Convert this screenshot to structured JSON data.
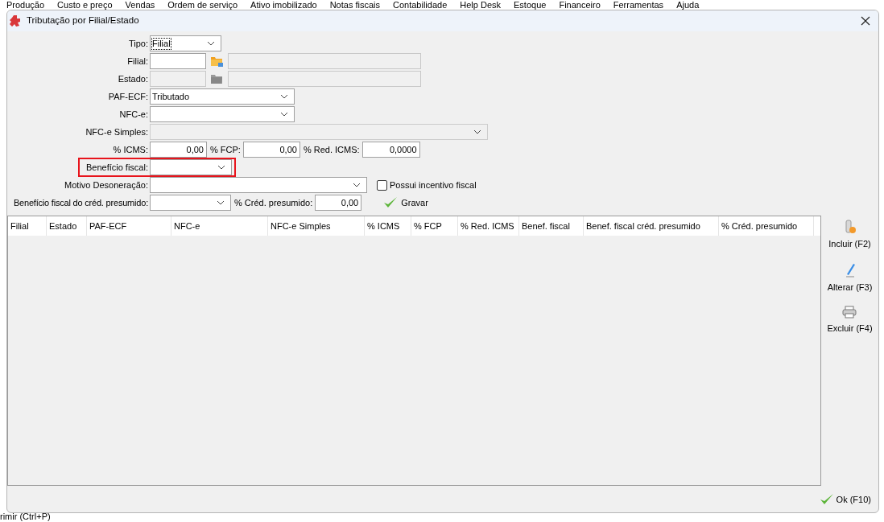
{
  "background": {
    "menu": [
      "Produção",
      "Custo e preço",
      "Vendas",
      "Ordem de serviço",
      "Ativo imobilizado",
      "Notas fiscais",
      "Contabilidade",
      "Help Desk",
      "Estoque",
      "Financeiro",
      "Ferramentas",
      "Ajuda"
    ],
    "footer_text": "rimir (Ctrl+P)"
  },
  "window": {
    "title": "Tributação por Filial/Estado"
  },
  "form": {
    "tipo": {
      "label": "Tipo:",
      "value": "Filial",
      "focused": true
    },
    "filial": {
      "label": "Filial:",
      "disabled": false
    },
    "estado": {
      "label": "Estado:",
      "disabled": true
    },
    "paf_ecf": {
      "label": "PAF-ECF:",
      "value": "Tributado"
    },
    "nfce": {
      "label": "NFC-e:"
    },
    "nfce_simples": {
      "label": "NFC-e Simples:",
      "disabled": true
    },
    "icms": {
      "label": "% ICMS:",
      "value": "0,00"
    },
    "fcp": {
      "label": "% FCP:",
      "value": "0,00"
    },
    "red_icms": {
      "label": "% Red. ICMS:",
      "value": "0,0000"
    },
    "beneficio_fiscal": {
      "label": "Benefício fiscal:",
      "highlighted": true
    },
    "motivo_desoneracao": {
      "label": "Motivo Desoneração:"
    },
    "possui_incentivo": {
      "label": "Possui incentivo fiscal",
      "checked": false
    },
    "beneficio_cred_presumido": {
      "label": "Benefício fiscal do créd. presumido:"
    },
    "cred_presumido": {
      "label": "% Créd. presumido:",
      "value": "0,00"
    },
    "gravar": {
      "label": "Gravar"
    }
  },
  "table": {
    "columns": [
      "Filial",
      "Estado",
      "PAF-ECF",
      "NFC-e",
      "NFC-e Simples",
      "% ICMS",
      "% FCP",
      "% Red. ICMS",
      "Benef. fiscal",
      "Benef. fiscal créd. presumido",
      "% Créd. presumido"
    ]
  },
  "side_buttons": [
    {
      "kind": "add",
      "label": "Incluir (F2)"
    },
    {
      "kind": "edit",
      "label": "Alterar (F3)"
    },
    {
      "kind": "delete",
      "label": "Excluir (F4)"
    }
  ],
  "ok_button": {
    "label": "Ok (F10)"
  }
}
